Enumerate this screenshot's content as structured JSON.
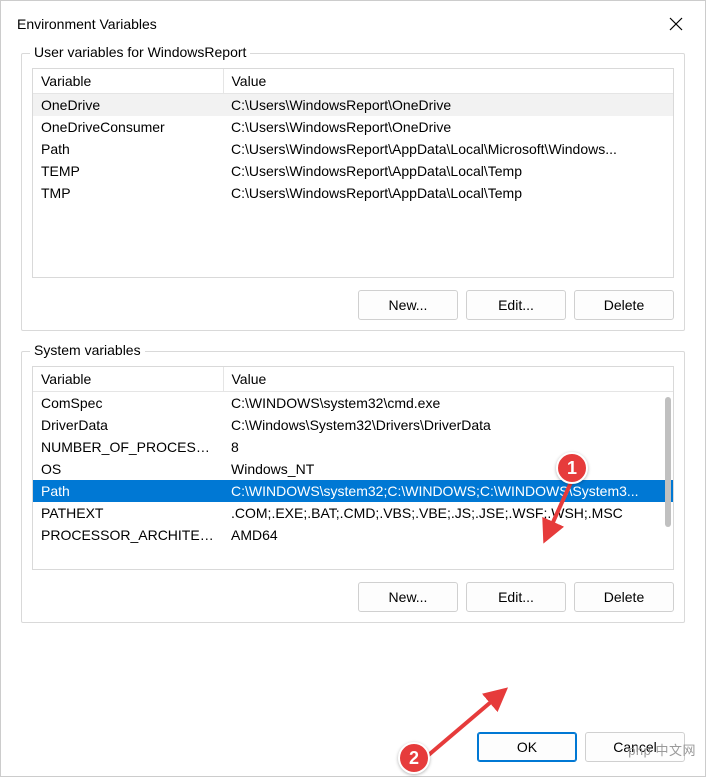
{
  "window": {
    "title": "Environment Variables"
  },
  "user_section": {
    "label": "User variables for WindowsReport",
    "columns": {
      "var": "Variable",
      "val": "Value"
    },
    "rows": [
      {
        "var": "OneDrive",
        "val": "C:\\Users\\WindowsReport\\OneDrive",
        "state": "hover"
      },
      {
        "var": "OneDriveConsumer",
        "val": "C:\\Users\\WindowsReport\\OneDrive",
        "state": ""
      },
      {
        "var": "Path",
        "val": "C:\\Users\\WindowsReport\\AppData\\Local\\Microsoft\\Windows...",
        "state": ""
      },
      {
        "var": "TEMP",
        "val": "C:\\Users\\WindowsReport\\AppData\\Local\\Temp",
        "state": ""
      },
      {
        "var": "TMP",
        "val": "C:\\Users\\WindowsReport\\AppData\\Local\\Temp",
        "state": ""
      }
    ],
    "buttons": {
      "new": "New...",
      "edit": "Edit...",
      "delete": "Delete"
    }
  },
  "system_section": {
    "label": "System variables",
    "columns": {
      "var": "Variable",
      "val": "Value"
    },
    "rows": [
      {
        "var": "ComSpec",
        "val": "C:\\WINDOWS\\system32\\cmd.exe",
        "state": ""
      },
      {
        "var": "DriverData",
        "val": "C:\\Windows\\System32\\Drivers\\DriverData",
        "state": ""
      },
      {
        "var": "NUMBER_OF_PROCESSORS",
        "val": "8",
        "state": ""
      },
      {
        "var": "OS",
        "val": "Windows_NT",
        "state": ""
      },
      {
        "var": "Path",
        "val": "C:\\WINDOWS\\system32;C:\\WINDOWS;C:\\WINDOWS\\System3...",
        "state": "selected"
      },
      {
        "var": "PATHEXT",
        "val": ".COM;.EXE;.BAT;.CMD;.VBS;.VBE;.JS;.JSE;.WSF;.WSH;.MSC",
        "state": ""
      },
      {
        "var": "PROCESSOR_ARCHITECTU...",
        "val": "AMD64",
        "state": ""
      }
    ],
    "buttons": {
      "new": "New...",
      "edit": "Edit...",
      "delete": "Delete"
    }
  },
  "dialog_buttons": {
    "ok": "OK",
    "cancel": "Cancel"
  },
  "annotations": {
    "a1": "1",
    "a2": "2"
  },
  "watermark": "php 中文网"
}
